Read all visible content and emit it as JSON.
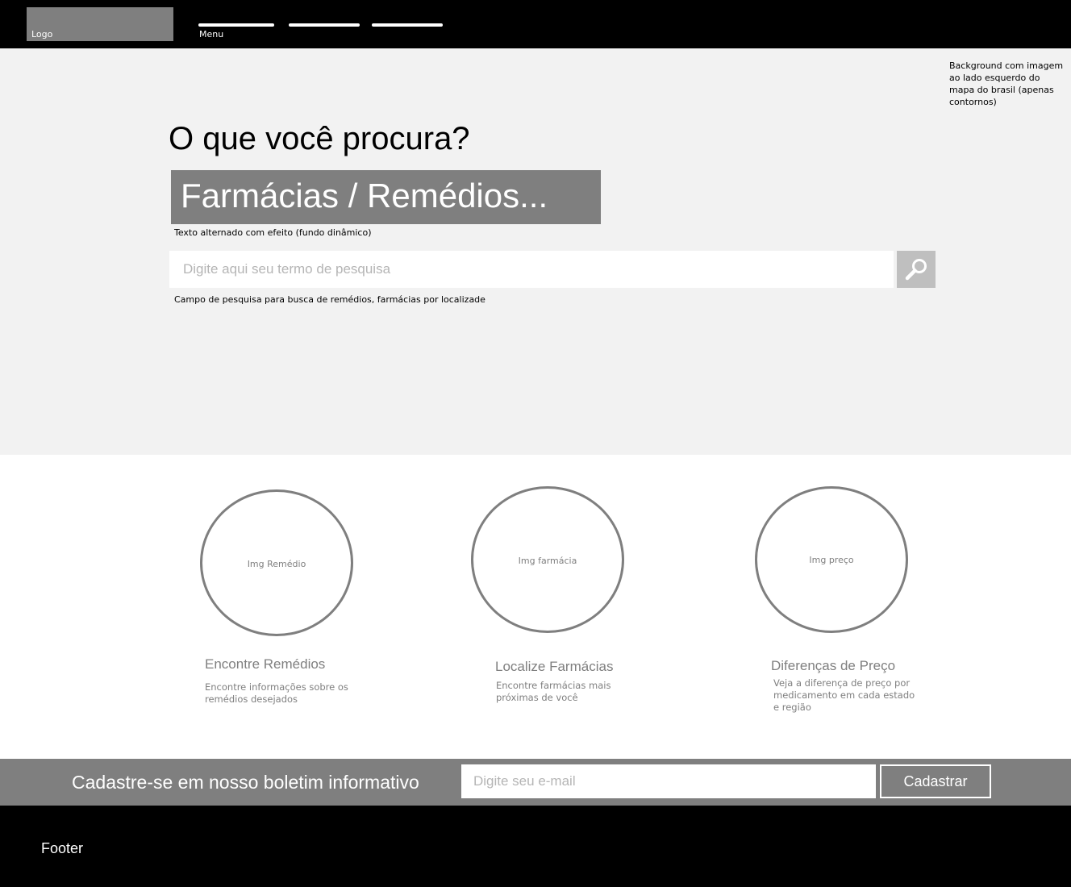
{
  "header": {
    "logo_label": "Logo",
    "menu_label": "Menu"
  },
  "hero": {
    "background_note": "Background com imagem ao lado esquerdo do mapa do brasil (apenas contornos)",
    "title": "O que você procura?",
    "rotating_text": "Farmácias / Remédios...",
    "rotating_note": "Texto alternado com efeito (fundo dinâmico)",
    "search_placeholder": "Digite aqui seu termo de pesquisa",
    "search_icon": "search-icon",
    "search_note": "Campo de pesquisa para busca de remédios, farmácias por localizade"
  },
  "features": [
    {
      "image_label": "Img Remédio",
      "title": "Encontre Remédios",
      "description": "Encontre informações sobre os remédios desejados"
    },
    {
      "image_label": "Img farmácia",
      "title": "Localize Farmácias",
      "description": "Encontre farmácias mais próximas de você"
    },
    {
      "image_label": "Img preço",
      "title": "Diferenças de Preço",
      "description": "Veja a diferença de preço por medicamento em cada estado e região"
    }
  ],
  "newsletter": {
    "title": "Cadastre-se em nosso boletim informativo",
    "email_placeholder": "Digite seu e-mail",
    "button_label": "Cadastrar"
  },
  "footer": {
    "label": "Footer"
  },
  "colors": {
    "header_bg": "#000000",
    "hero_bg": "#f2f2f2",
    "placeholder_gray": "#7f7f7f",
    "search_button_bg": "#bfbfbf"
  }
}
